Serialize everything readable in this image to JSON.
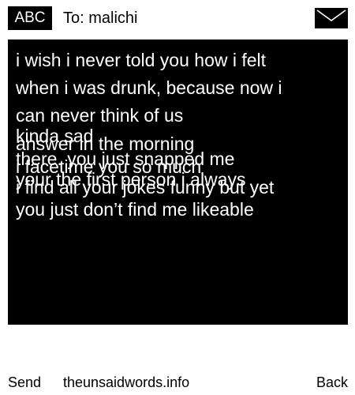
{
  "header": {
    "badge": "ABC",
    "to_line": "To: malichi",
    "icon": "envelope-icon"
  },
  "message": {
    "lines": [
      "i wish i never told you how i felt",
      "when i was drunk, because now i",
      "can never think of us",
      "kinda sad",
      "answer in the morning",
      "there. you just snapped me",
      "i facetime you so much",
      "your the first person i always",
      "i find all your jokes funny but yet",
      "you just don’t find me likeable"
    ]
  },
  "footer": {
    "send_label": "Send",
    "site_label": "theunsaidwords.info",
    "back_label": "Back"
  },
  "colors": {
    "background": "#ffffff",
    "panel": "#000000",
    "text_on_panel": "#ffffff"
  }
}
